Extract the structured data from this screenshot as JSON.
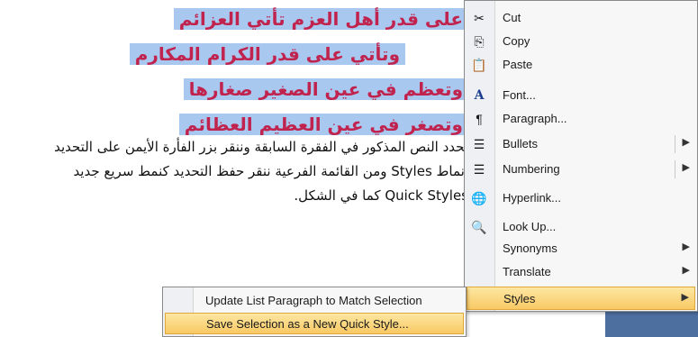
{
  "document": {
    "poem_lines": [
      "على قدر أهل العزم تأتي العزائم",
      "وتأتي على قدر الكرام المكارم",
      "وتعظم في عين الصغير صغارها",
      "وتصغر في عين العظيم العظائم"
    ],
    "body_lines": [
      "نحدد النص المذكور في الفقرة السابقة وننقر بزر الفأرة الأيمن على التحديد",
      "أنماط  Styles ومن القائمة الفرعية ننقر حفظ التحديد كنمط سريع جديد",
      "Quick Styles كما في الشكل."
    ]
  },
  "context_menu": {
    "items": [
      {
        "label": "Cut",
        "icon": "scissors-icon",
        "glyph": "✂"
      },
      {
        "label": "Copy",
        "icon": "copy-icon",
        "glyph": "⎘"
      },
      {
        "label": "Paste",
        "icon": "paste-icon",
        "glyph": "📋"
      },
      {
        "label": "Font...",
        "icon": "font-icon",
        "glyph": "A"
      },
      {
        "label": "Paragraph...",
        "icon": "paragraph-icon",
        "glyph": "¶"
      },
      {
        "label": "Bullets",
        "icon": "bullets-icon",
        "glyph": "☰"
      },
      {
        "label": "Numbering",
        "icon": "numbering-icon",
        "glyph": "☰"
      },
      {
        "label": "Hyperlink...",
        "icon": "hyperlink-icon",
        "glyph": "🌐"
      },
      {
        "label": "Look Up...",
        "icon": "lookup-icon",
        "glyph": "🔍"
      },
      {
        "label": "Synonyms",
        "icon": "",
        "glyph": ""
      },
      {
        "label": "Translate",
        "icon": "",
        "glyph": ""
      },
      {
        "label": "Styles",
        "icon": "",
        "glyph": ""
      }
    ],
    "arrow_glyph": "▶"
  },
  "styles_submenu": {
    "items": [
      {
        "label": "Update List Paragraph to Match Selection"
      },
      {
        "label": "Save Selection as a New Quick Style..."
      }
    ]
  },
  "colors": {
    "poem_text": "#c0234e",
    "selection_highlight": "#a9c8ef",
    "menu_highlight": "#f8c964",
    "blue_block": "#4d6fa0"
  }
}
